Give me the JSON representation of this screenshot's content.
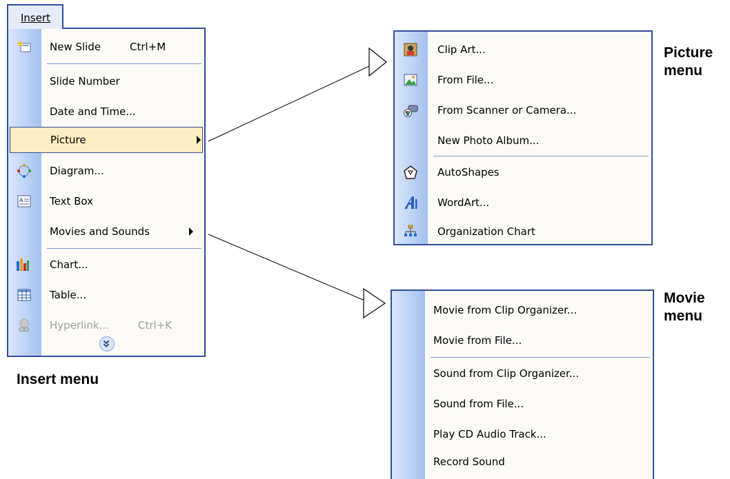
{
  "insert_menu": {
    "title": "Insert",
    "items": [
      {
        "label": "New Slide",
        "shortcut": "Ctrl+M",
        "icon": "new-slide-icon"
      },
      {
        "label": "Slide Number"
      },
      {
        "label": "Date and Time..."
      },
      {
        "label": "Picture",
        "submenu": true,
        "highlighted": true
      },
      {
        "label": "Diagram...",
        "icon": "diagram-icon"
      },
      {
        "label": "Text Box",
        "icon": "text-box-icon"
      },
      {
        "label": "Movies and Sounds",
        "submenu": true
      },
      {
        "label": "Chart...",
        "icon": "chart-icon"
      },
      {
        "label": "Table...",
        "icon": "table-icon"
      },
      {
        "label": "Hyperlink...",
        "shortcut": "Ctrl+K",
        "icon": "hyperlink-icon",
        "disabled": true
      }
    ],
    "expand_icon": "chevron-double-down-icon"
  },
  "picture_menu": {
    "items": [
      {
        "label": "Clip Art...",
        "icon": "clip-art-icon"
      },
      {
        "label": "From File...",
        "icon": "from-file-icon"
      },
      {
        "label": "From Scanner or Camera...",
        "icon": "scanner-camera-icon"
      },
      {
        "label": "New Photo Album..."
      },
      {
        "label": "AutoShapes",
        "icon": "autoshapes-icon"
      },
      {
        "label": "WordArt...",
        "icon": "wordart-icon"
      },
      {
        "label": "Organization Chart",
        "icon": "org-chart-icon"
      }
    ]
  },
  "movie_menu": {
    "items": [
      {
        "label": "Movie from Clip Organizer..."
      },
      {
        "label": "Movie from File..."
      },
      {
        "label": "Sound from Clip Organizer..."
      },
      {
        "label": "Sound from File..."
      },
      {
        "label": "Play CD Audio Track..."
      },
      {
        "label": "Record Sound"
      }
    ]
  },
  "captions": {
    "insert": "Insert menu",
    "picture": "Picture\nmenu",
    "movie": "Movie\nmenu"
  },
  "colors": {
    "menu_border": "#2f4c9a",
    "highlight": "#ffeec2",
    "strip": "#bcd2f6"
  }
}
